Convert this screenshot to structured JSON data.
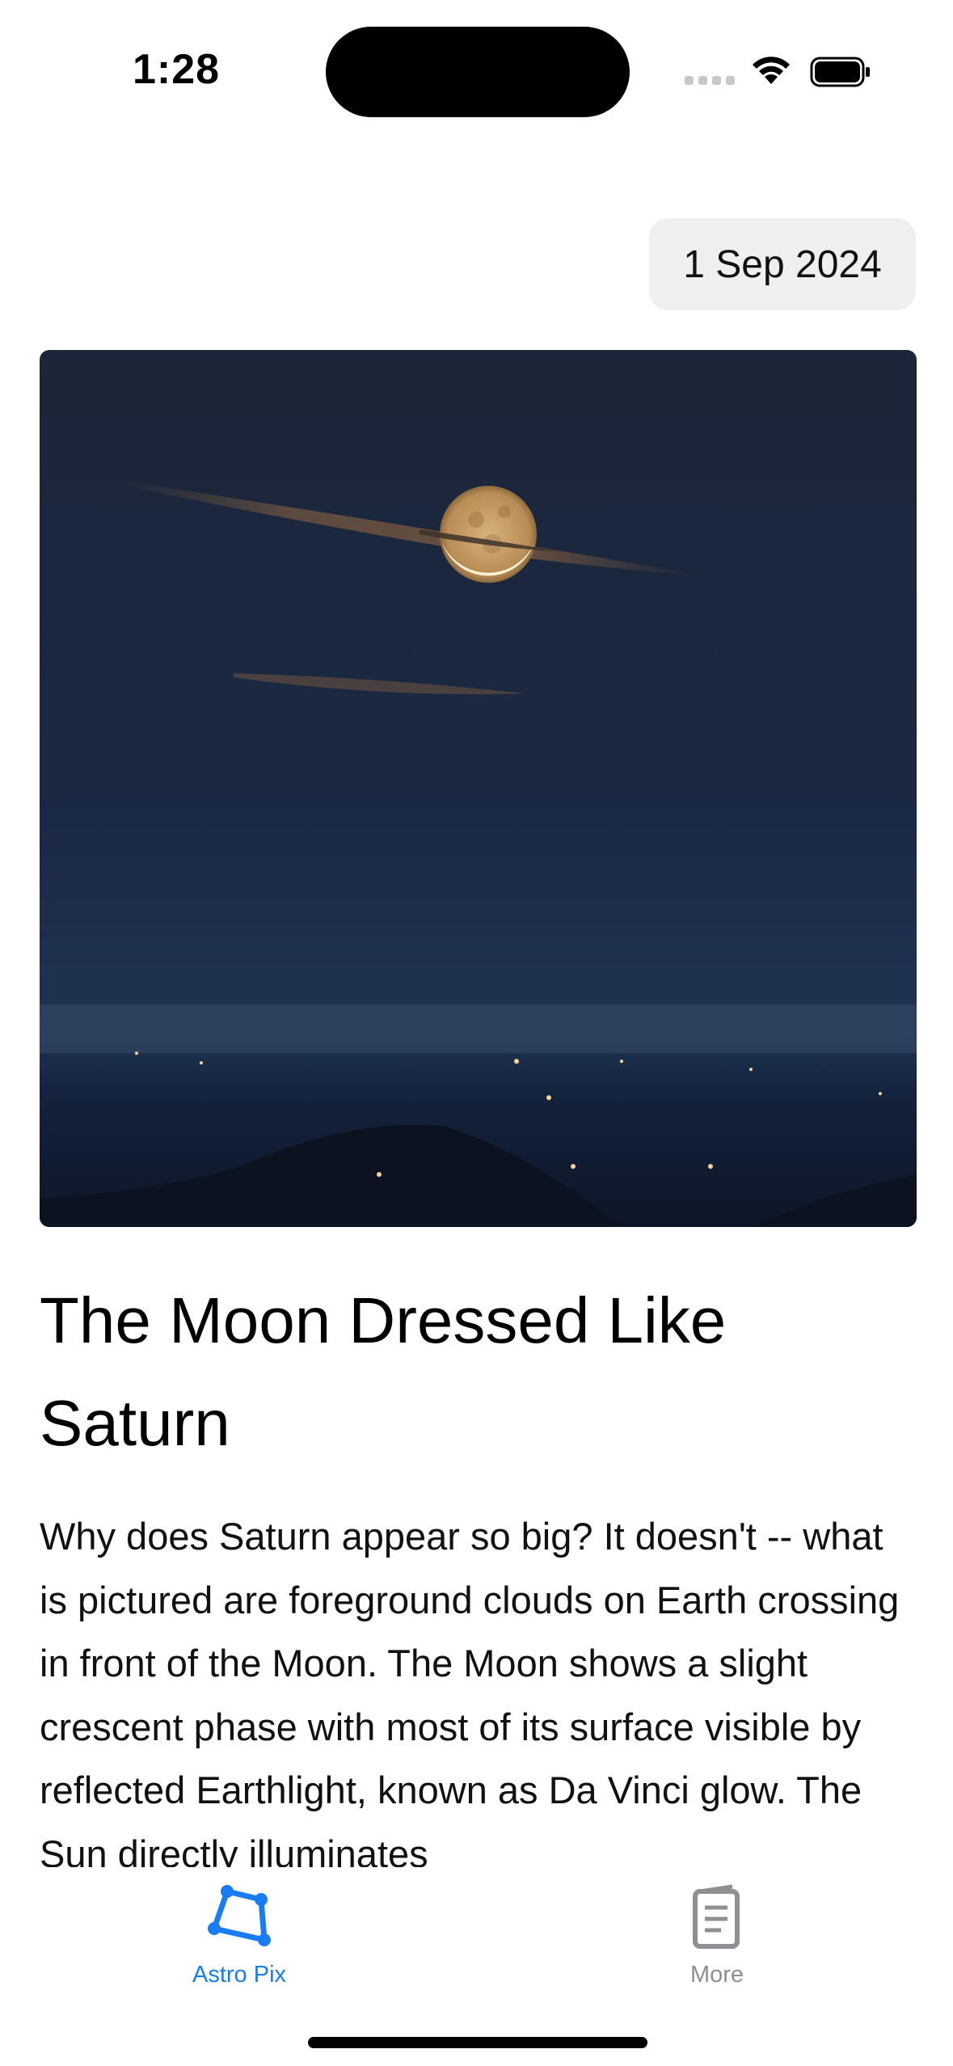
{
  "status": {
    "time": "1:28",
    "signal_icon": "cellular-signal-icon",
    "wifi_icon": "wifi-icon",
    "battery_icon": "battery-icon"
  },
  "date_button": {
    "label": "1 Sep 2024"
  },
  "apod": {
    "image_alt": "Night sky with a crescent Moon behind thin clouds over mountains and town lights",
    "title": "The Moon Dressed Like Saturn",
    "explanation": "Why does Saturn appear so big? It doesn't -- what is pictured are foreground clouds on Earth crossing in front of the Moon. The Moon shows a slight crescent phase with most of its surface visible by reflected Earthlight, known as Da Vinci glow. The Sun directly illuminates"
  },
  "tabs": [
    {
      "label": "Astro Pix",
      "icon": "constellation-icon",
      "selected": true,
      "color": "#1a7cf2"
    },
    {
      "label": "More",
      "icon": "document-icon",
      "selected": false,
      "color": "#8e8e93"
    }
  ]
}
